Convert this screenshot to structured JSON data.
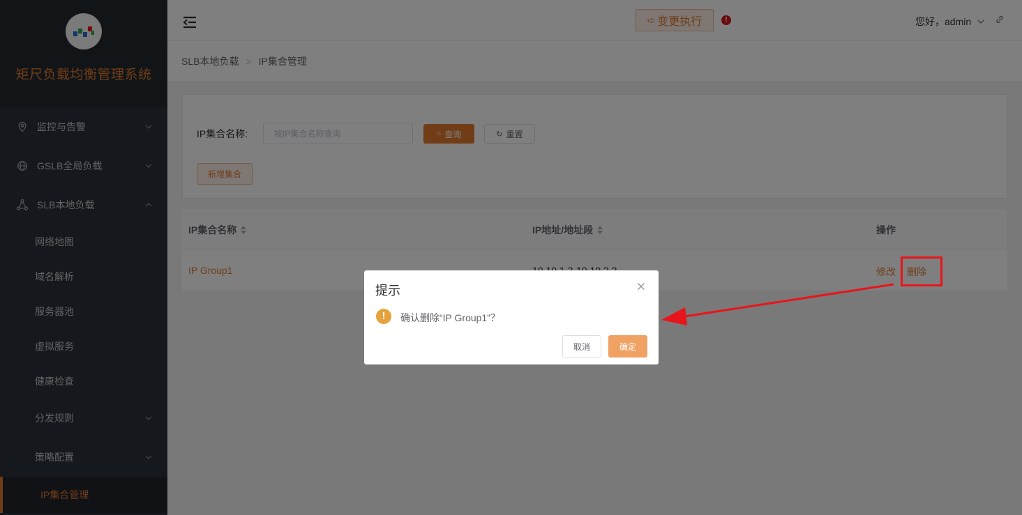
{
  "colors": {
    "accent": "#e07a2e",
    "sidebar_bg": "#2b3038",
    "danger": "#e8141b",
    "warning": "#e6a23c"
  },
  "sidebar": {
    "logo_icon": "wave-logo-icon",
    "app_title": "矩尺负载均衡管理系统",
    "menu": [
      {
        "label": "监控与告警",
        "icon": "location-pin-icon"
      },
      {
        "label": "GSLB全局负载",
        "icon": "globe-icon"
      },
      {
        "label": "SLB本地负载",
        "icon": "network-nodes-icon"
      }
    ],
    "submenu": [
      {
        "label": "网络地图"
      },
      {
        "label": "域名解析"
      },
      {
        "label": "服务器池"
      },
      {
        "label": "虚拟服务"
      },
      {
        "label": "健康检查"
      },
      {
        "label": "分发规则"
      },
      {
        "label": "策略配置"
      },
      {
        "label": "IP集合管理"
      }
    ]
  },
  "topbar": {
    "exec_label": "变更执行",
    "alert_icon": "!",
    "greeting": "您好，admin"
  },
  "breadcrumb": {
    "items": [
      "SLB本地负载",
      "IP集合管理"
    ]
  },
  "search": {
    "label": "IP集合名称:",
    "placeholder": "按IP集合名称查询",
    "query_label": "查询",
    "reset_label": "重置",
    "add_label": "新增集合"
  },
  "table": {
    "headers": {
      "name": "IP集合名称",
      "ip": "IP地址/地址段",
      "ops": "操作"
    },
    "rows": [
      {
        "name": "IP Group1",
        "ip": "10.10.1.2-10.10.2.2",
        "edit": "修改",
        "delete": "删除"
      }
    ]
  },
  "dialog": {
    "title": "提示",
    "warn_icon": "!",
    "message": "确认删除“IP Group1”？",
    "cancel_label": "取消",
    "ok_label": "确定"
  }
}
